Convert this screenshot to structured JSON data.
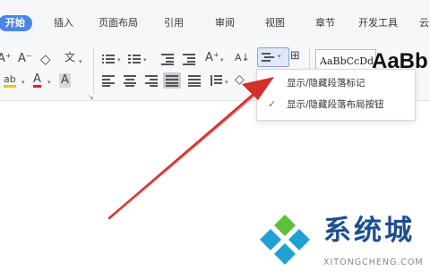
{
  "menu": {
    "tabs": [
      {
        "label": "开始",
        "active": true
      },
      {
        "label": "插入"
      },
      {
        "label": "页面布局"
      },
      {
        "label": "引用"
      },
      {
        "label": "审阅"
      },
      {
        "label": "视图"
      },
      {
        "label": "章节"
      },
      {
        "label": "开发工具"
      },
      {
        "label": "云"
      }
    ]
  },
  "ribbon": {
    "font_size_up": "A⁺",
    "font_size_down": "A⁻",
    "clear_format": "◇",
    "phonetic": "文",
    "highlight": "ab",
    "font_color": "A",
    "char_shading": "A",
    "sort": "A↓",
    "style_preview_text": "AaBbCcDd",
    "style_heading_text": "AaBb"
  },
  "dropdown": {
    "items": [
      {
        "label": "显示/隐藏段落标记",
        "checked": false
      },
      {
        "label": "显示/隐藏段落布局按钮",
        "checked": true
      }
    ]
  },
  "watermark": {
    "text": "系统城",
    "url": "XITONGCHENG.COM"
  },
  "colors": {
    "active_tab": "#4a86e8",
    "annotation_arrow": "#d32f2f",
    "watermark_blue": "#1d4e8f",
    "watermark_green": "#5bbf3a",
    "watermark_cyan": "#21a0d6"
  }
}
